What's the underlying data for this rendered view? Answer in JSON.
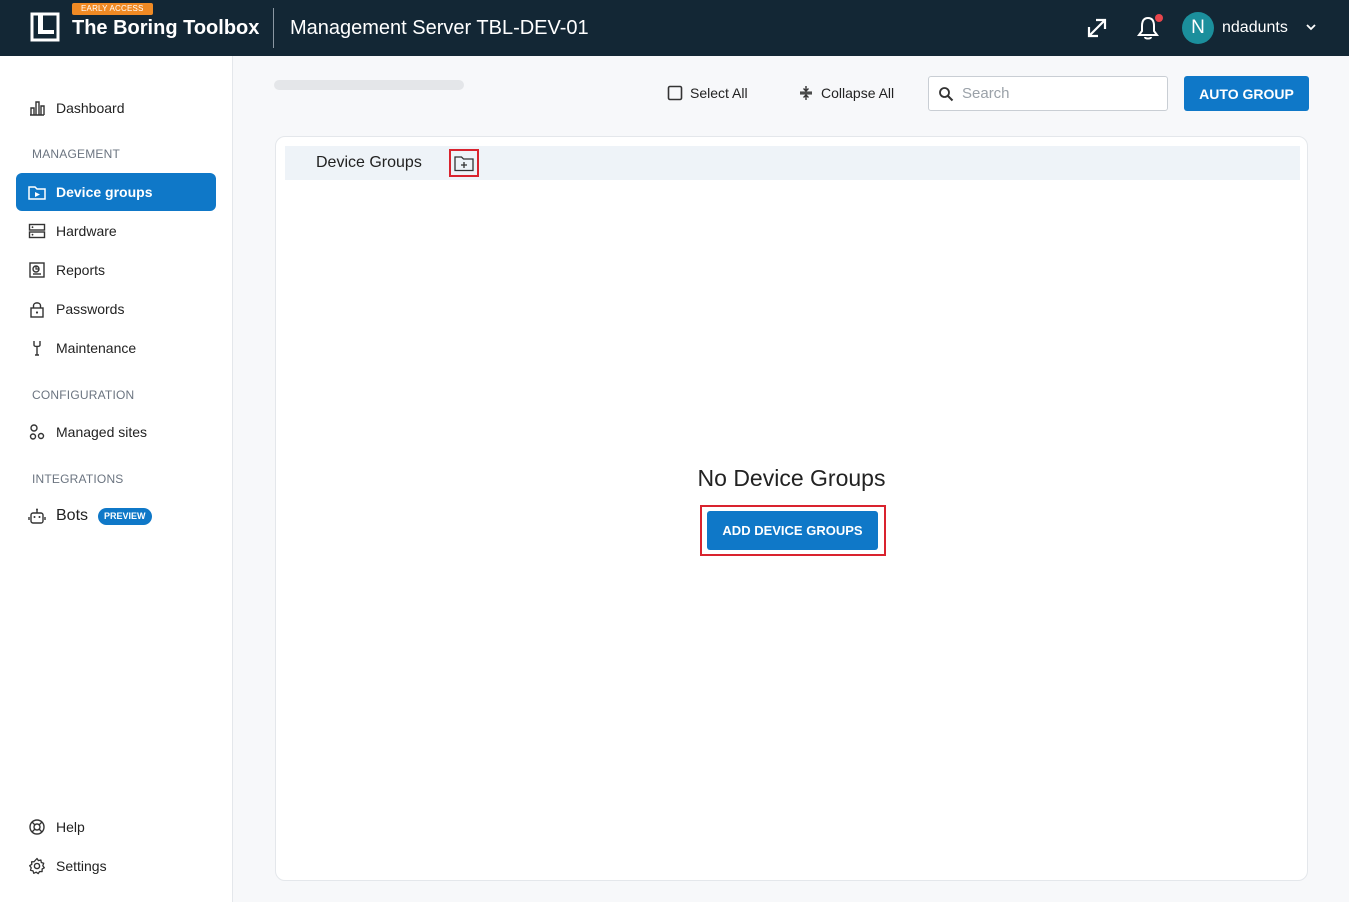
{
  "header": {
    "badge": "EARLY ACCESS",
    "brand": "The Boring Toolbox",
    "server_title": "Management Server TBL-DEV-01",
    "user_initial": "N",
    "username": "ndadunts",
    "accent": "#0f78c8",
    "background": "#132735"
  },
  "sidebar": {
    "dashboard": "Dashboard",
    "management_label": "MANAGEMENT",
    "management_items": [
      {
        "label": "Device groups",
        "icon": "folder-play-icon",
        "active": true
      },
      {
        "label": "Hardware",
        "icon": "server-icon"
      },
      {
        "label": "Reports",
        "icon": "report-icon"
      },
      {
        "label": "Passwords",
        "icon": "lock-icon"
      },
      {
        "label": "Maintenance",
        "icon": "wrench-icon"
      }
    ],
    "configuration_label": "CONFIGURATION",
    "managed_sites": "Managed sites",
    "integrations_label": "INTEGRATIONS",
    "bots": "Bots",
    "bots_badge": "PREVIEW",
    "help": "Help",
    "settings": "Settings"
  },
  "toolbar": {
    "select_all": "Select All",
    "collapse_all": "Collapse All",
    "search_placeholder": "Search",
    "auto_group": "AUTO GROUP"
  },
  "panel": {
    "header_title": "Device Groups",
    "empty_title": "No Device Groups",
    "add_button": "ADD DEVICE GROUPS"
  }
}
